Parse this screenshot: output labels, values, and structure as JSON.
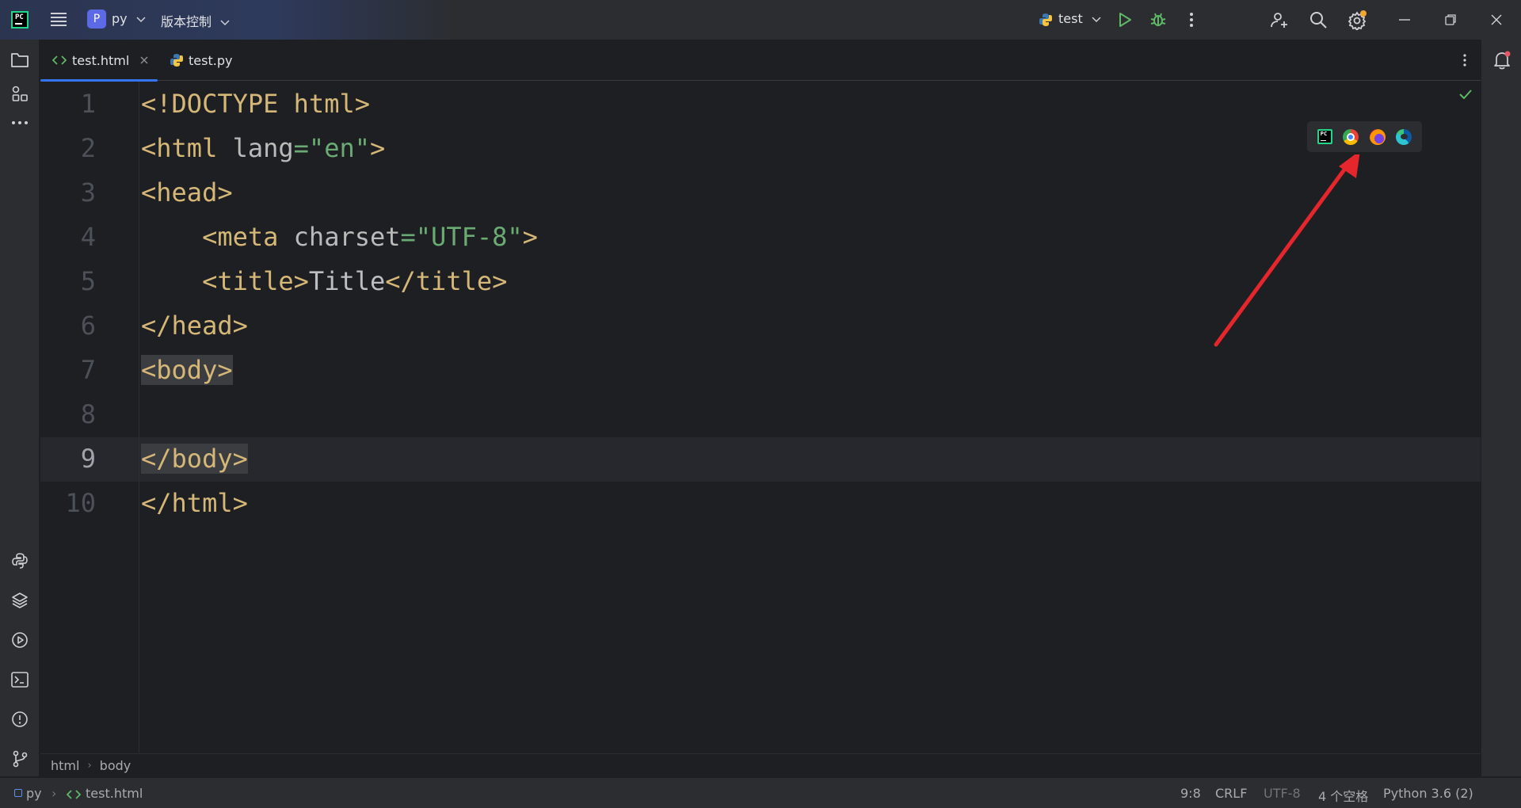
{
  "titlebar": {
    "project_initial": "P",
    "project_name": "py",
    "vcs_label": "版本控制",
    "run_config": "test"
  },
  "tabs": [
    {
      "label": "test.html",
      "active": true
    },
    {
      "label": "test.py",
      "active": false
    }
  ],
  "editor": {
    "line_numbers": [
      "1",
      "2",
      "3",
      "4",
      "5",
      "6",
      "7",
      "8",
      "9",
      "10"
    ],
    "current_line": "9"
  },
  "code": {
    "l1": {
      "tag": "<!DOCTYPE html>"
    },
    "l2": {
      "open": "<html ",
      "attr": "lang",
      "eq": "=",
      "val": "\"en\"",
      "close": ">"
    },
    "l3": {
      "tag": "<head>"
    },
    "l4": {
      "indent": "    ",
      "open": "<meta ",
      "attr": "charset",
      "eq": "=",
      "val": "\"UTF-8\"",
      "close": ">"
    },
    "l5": {
      "indent": "    ",
      "open": "<title>",
      "text": "Title",
      "close": "</title>"
    },
    "l6": {
      "tag": "</head>"
    },
    "l7": {
      "tag": "<body>"
    },
    "l9": {
      "tag": "</body>"
    },
    "l10": {
      "tag": "</html>"
    }
  },
  "breadcrumbs": [
    "html",
    "body"
  ],
  "statusbar": {
    "project": "py",
    "file": "test.html",
    "position": "9:8",
    "line_ending": "CRLF",
    "encoding": "UTF-8",
    "indent": "4 个空格",
    "interpreter": "Python 3.6 (2)"
  },
  "colors": {
    "accent": "#3574f0",
    "tag": "#d5b778",
    "string": "#6aab73",
    "arrow": "#e5262c"
  },
  "browser_icons": [
    "pycharm-icon",
    "chrome-icon",
    "firefox-icon",
    "edge-icon"
  ]
}
